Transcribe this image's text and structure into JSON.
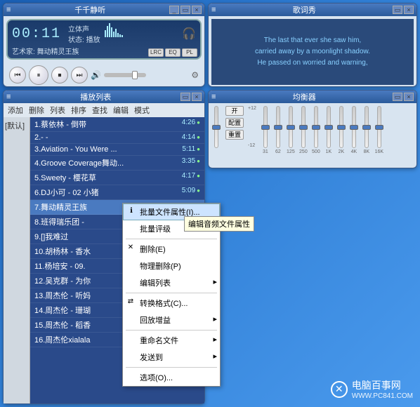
{
  "player": {
    "title": "千千静听",
    "time": "00:11",
    "stereo": "立体声",
    "status_label": "状态:",
    "status": "播放",
    "artist_label": "艺术家:",
    "artist": "舞动精灵王族",
    "badges": {
      "lrc": "LRC",
      "eq": "EQ",
      "pl": "PL"
    }
  },
  "lyrics": {
    "title": "歌词秀",
    "lines": [
      "The last that ever she saw him,",
      "carried away by a moonlight shadow.",
      "He passed on worried and warning,"
    ]
  },
  "playlist": {
    "title": "播放列表",
    "menu": [
      "添加",
      "删除",
      "列表",
      "排序",
      "查找",
      "编辑",
      "模式"
    ],
    "default_tab": "[默认]",
    "tracks": [
      {
        "n": "1",
        "name": "蔡依林 - 倒带",
        "dur": "4:26"
      },
      {
        "n": "2",
        "name": "- -",
        "dur": "4:14"
      },
      {
        "n": "3",
        "name": "Aviation - You Were ...",
        "dur": "5:11"
      },
      {
        "n": "4",
        "name": "Groove Coverage舞动...",
        "dur": "3:35"
      },
      {
        "n": "5",
        "name": "Sweety - 樱花草",
        "dur": "4:17"
      },
      {
        "n": "6",
        "name": "DJ小可 - 02 小猪",
        "dur": "5:09"
      },
      {
        "n": "7",
        "name": "舞动精灵王族",
        "dur": ""
      },
      {
        "n": "8",
        "name": "班得瑞乐团 -",
        "dur": ""
      },
      {
        "n": "9",
        "name": "[]我难过",
        "dur": ""
      },
      {
        "n": "10",
        "name": "胡杨林 - 香水",
        "dur": ""
      },
      {
        "n": "11",
        "name": "杨培安 - 09.",
        "dur": ""
      },
      {
        "n": "12",
        "name": "吴克群 - 为你",
        "dur": ""
      },
      {
        "n": "13",
        "name": "周杰伦 - 听妈",
        "dur": ""
      },
      {
        "n": "14",
        "name": "周杰伦 - 珊瑚",
        "dur": ""
      },
      {
        "n": "15",
        "name": "周杰伦 - 稻香",
        "dur": ""
      },
      {
        "n": "16",
        "name": "周杰伦xialala",
        "dur": ""
      }
    ]
  },
  "equalizer": {
    "title": "均衡器",
    "marks": {
      "top": "+12",
      "bot": "-12"
    },
    "buttons": {
      "on": "开",
      "config": "配置",
      "reset": "重置"
    },
    "bands": [
      "31",
      "62",
      "125",
      "250",
      "500",
      "1K",
      "2K",
      "4K",
      "8K",
      "16K"
    ]
  },
  "context_menu": {
    "items": [
      {
        "label": "批量文件属性(I)...",
        "hover": true,
        "icon": "info"
      },
      {
        "label": "批量评级",
        "arrow": true
      },
      {
        "sep": true
      },
      {
        "label": "删除(E)",
        "icon": "x"
      },
      {
        "label": "物理删除(P)"
      },
      {
        "label": "编辑列表",
        "arrow": true
      },
      {
        "sep": true
      },
      {
        "label": "转换格式(C)...",
        "icon": "conv"
      },
      {
        "label": "回放增益",
        "arrow": true
      },
      {
        "sep": true
      },
      {
        "label": "重命名文件",
        "arrow": true
      },
      {
        "label": "发送到",
        "arrow": true
      },
      {
        "sep": true
      },
      {
        "label": "选项(O)..."
      }
    ]
  },
  "tooltip": "编辑音频文件属性",
  "watermark": {
    "brand": "电脑百事网",
    "url": "WWW.PC841.COM"
  }
}
